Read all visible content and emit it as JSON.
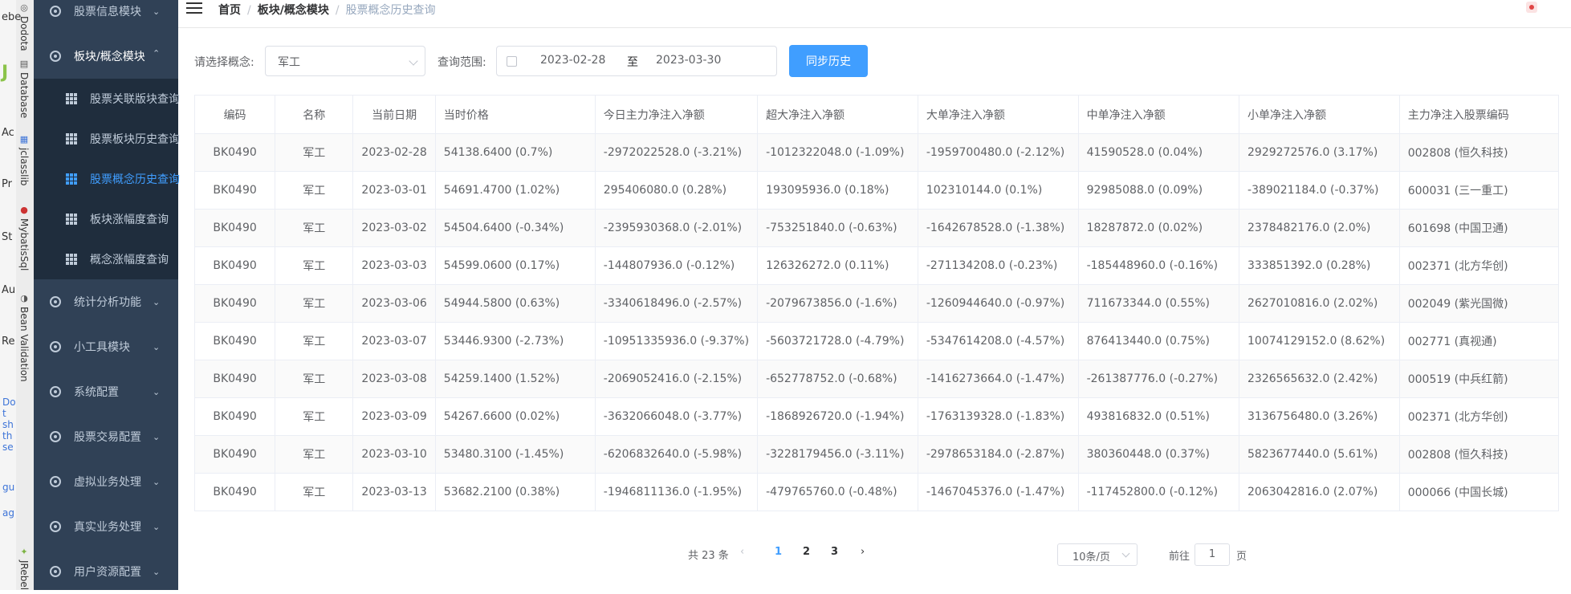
{
  "ide": {
    "left_letters": [
      "ebe",
      "J",
      "Ac",
      "Pr",
      "St",
      "Au",
      "Re"
    ],
    "blue_text": "Do\nt\nsh\nth\nse",
    "blue_text2": "gu",
    "blue_text3": "ag",
    "tabs": [
      {
        "label": "Dodota",
        "icon": "database-icon"
      },
      {
        "label": "Database",
        "icon": "database-icon"
      },
      {
        "label": "jclasslib",
        "icon": "bytecode-icon"
      },
      {
        "label": "MybatisSql",
        "icon": "bird-icon"
      },
      {
        "label": "Bean Validation",
        "icon": "validation-icon"
      },
      {
        "label": "JRebel",
        "icon": "jrebel-icon"
      }
    ]
  },
  "sidebar": {
    "items": [
      {
        "label": "股票信息模块",
        "expanded": false
      },
      {
        "label": "板块/概念模块",
        "expanded": true
      },
      {
        "label": "统计分析功能",
        "expanded": false
      },
      {
        "label": "小工具模块",
        "expanded": false
      },
      {
        "label": "系统配置",
        "expanded": false
      },
      {
        "label": "股票交易配置",
        "expanded": false
      },
      {
        "label": "虚拟业务处理",
        "expanded": false
      },
      {
        "label": "真实业务处理",
        "expanded": false
      },
      {
        "label": "用户资源配置",
        "expanded": false
      }
    ],
    "sub_items": [
      {
        "label": "股票关联版块查询",
        "active": false
      },
      {
        "label": "股票板块历史查询",
        "active": false
      },
      {
        "label": "股票概念历史查询",
        "active": true
      },
      {
        "label": "板块涨幅度查询",
        "active": false
      },
      {
        "label": "概念涨幅度查询",
        "active": false
      }
    ]
  },
  "breadcrumb": {
    "items": [
      "首页",
      "板块/概念模块",
      "股票概念历史查询"
    ]
  },
  "form": {
    "concept_label": "请选择概念:",
    "concept_value": "军工",
    "range_label": "查询范围:",
    "start_date": "2023-02-28",
    "range_sep": "至",
    "end_date": "2023-03-30",
    "sync_button": "同步历史"
  },
  "table": {
    "headers": [
      "编码",
      "名称",
      "当前日期",
      "当时价格",
      "今日主力净注入净额",
      "超大净注入净额",
      "大单净注入净额",
      "中单净注入净额",
      "小单净注入净额",
      "主力净注入股票编码"
    ],
    "rows": [
      [
        "BK0490",
        "军工",
        "2023-02-28",
        "54138.6400 (0.7%)",
        "-2972022528.0 (-3.21%)",
        "-1012322048.0 (-1.09%)",
        "-1959700480.0 (-2.12%)",
        "41590528.0 (0.04%)",
        "2929272576.0 (3.17%)",
        "002808 (恒久科技)"
      ],
      [
        "BK0490",
        "军工",
        "2023-03-01",
        "54691.4700 (1.02%)",
        "295406080.0 (0.28%)",
        "193095936.0 (0.18%)",
        "102310144.0 (0.1%)",
        "92985088.0 (0.09%)",
        "-389021184.0 (-0.37%)",
        "600031 (三一重工)"
      ],
      [
        "BK0490",
        "军工",
        "2023-03-02",
        "54504.6400 (-0.34%)",
        "-2395930368.0 (-2.01%)",
        "-753251840.0 (-0.63%)",
        "-1642678528.0 (-1.38%)",
        "18287872.0 (0.02%)",
        "2378482176.0 (2.0%)",
        "601698 (中国卫通)"
      ],
      [
        "BK0490",
        "军工",
        "2023-03-03",
        "54599.0600 (0.17%)",
        "-144807936.0 (-0.12%)",
        "126326272.0 (0.11%)",
        "-271134208.0 (-0.23%)",
        "-185448960.0 (-0.16%)",
        "333851392.0 (0.28%)",
        "002371 (北方华创)"
      ],
      [
        "BK0490",
        "军工",
        "2023-03-06",
        "54944.5800 (0.63%)",
        "-3340618496.0 (-2.57%)",
        "-2079673856.0 (-1.6%)",
        "-1260944640.0 (-0.97%)",
        "711673344.0 (0.55%)",
        "2627010816.0 (2.02%)",
        "002049 (紫光国微)"
      ],
      [
        "BK0490",
        "军工",
        "2023-03-07",
        "53446.9300 (-2.73%)",
        "-10951335936.0 (-9.37%)",
        "-5603721728.0 (-4.79%)",
        "-5347614208.0 (-4.57%)",
        "876413440.0 (0.75%)",
        "10074129152.0 (8.62%)",
        "002771 (真视通)"
      ],
      [
        "BK0490",
        "军工",
        "2023-03-08",
        "54259.1400 (1.52%)",
        "-2069052416.0 (-2.15%)",
        "-652778752.0 (-0.68%)",
        "-1416273664.0 (-1.47%)",
        "-261387776.0 (-0.27%)",
        "2326565632.0 (2.42%)",
        "000519 (中兵红箭)"
      ],
      [
        "BK0490",
        "军工",
        "2023-03-09",
        "54267.6600 (0.02%)",
        "-3632066048.0 (-3.77%)",
        "-1868926720.0 (-1.94%)",
        "-1763139328.0 (-1.83%)",
        "493816832.0 (0.51%)",
        "3136756480.0 (3.26%)",
        "002371 (北方华创)"
      ],
      [
        "BK0490",
        "军工",
        "2023-03-10",
        "53480.3100 (-1.45%)",
        "-6206832640.0 (-5.98%)",
        "-3228179456.0 (-3.11%)",
        "-2978653184.0 (-2.87%)",
        "380360448.0 (0.37%)",
        "5823677440.0 (5.61%)",
        "002808 (恒久科技)"
      ],
      [
        "BK0490",
        "军工",
        "2023-03-13",
        "53682.2100 (0.38%)",
        "-1946811136.0 (-1.95%)",
        "-479765760.0 (-0.48%)",
        "-1467045376.0 (-1.47%)",
        "-117452800.0 (-0.12%)",
        "2063042816.0 (2.07%)",
        "000066 (中国长城)"
      ]
    ]
  },
  "pagination": {
    "total": "共 23 条",
    "pages": [
      "1",
      "2",
      "3"
    ],
    "current": "1",
    "page_size": "10条/页",
    "goto_label": "前往",
    "goto_value": "1",
    "goto_suffix": "页",
    "prev_icon": "‹",
    "next_icon": "›"
  }
}
